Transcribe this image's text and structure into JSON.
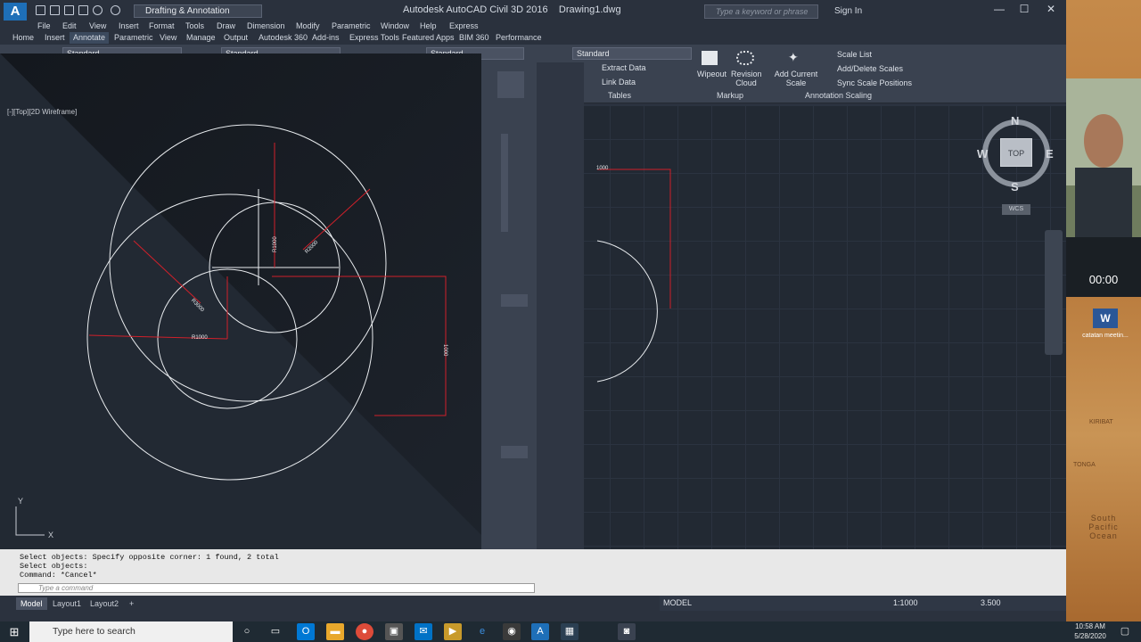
{
  "title_bar": {
    "app_title": "Autodesk AutoCAD Civil 3D 2016",
    "file_name": "Drawing1.dwg",
    "workspace": "Drafting & Annotation",
    "search_placeholder": "Type a keyword or phrase",
    "sign_in": "Sign In"
  },
  "menu": [
    "File",
    "Edit",
    "View",
    "Insert",
    "Format",
    "Tools",
    "Draw",
    "Dimension",
    "Modify",
    "Parametric",
    "Window",
    "Help",
    "Express"
  ],
  "ribbon_tabs": [
    "Home",
    "Insert",
    "Annotate",
    "Parametric",
    "View",
    "Manage",
    "Output",
    "Autodesk 360",
    "Add-ins",
    "Express Tools",
    "Featured Apps",
    "BIM 360",
    "Performance"
  ],
  "active_tab": "Annotate",
  "ribbon": {
    "text_style": "Standard",
    "dim_style": "Standard",
    "mleader_style": "Standard",
    "table_style": "Standard",
    "extract_data": "Extract Data",
    "link_data": "Link Data",
    "tables_panel": "Tables",
    "wipeout": "Wipeout",
    "revision_cloud": "Revision Cloud",
    "markup_panel": "Markup",
    "add_current_scale": "Add Current Scale",
    "scale_list": "Scale List",
    "add_delete_scales": "Add/Delete Scales",
    "sync_scale_positions": "Sync Scale Positions",
    "annotation_scaling_panel": "Annotation Scaling"
  },
  "viewport_label": "[-][Top][2D Wireframe]",
  "viewcube": {
    "top": "TOP",
    "north": "N",
    "south": "S",
    "east": "E",
    "west": "W",
    "wcs": "WCS"
  },
  "drawing_labels": {
    "r1000_a": "R1000",
    "r1000_b": "R1000",
    "r2000": "R2000",
    "d3000": "R3000",
    "dim_1000_top": "1000",
    "dim_1000_side": "1000"
  },
  "command": {
    "history": [
      "Select objects: Specify opposite corner: 1 found, 2 total",
      "Select objects:",
      "Command: *Cancel*"
    ],
    "placeholder": "Type a command"
  },
  "layout_tabs": [
    "Model",
    "Layout1",
    "Layout2"
  ],
  "status": {
    "model": "MODEL",
    "scale": "1:1000",
    "annotation_value": "3.500"
  },
  "webcam": {
    "timer": "00:00"
  },
  "desktop": {
    "word_label": "catatan meetin..."
  },
  "map_labels": {
    "kiribati": "KIRIBAT",
    "tonga": "TONGA",
    "ocean": "South Pacific Ocean"
  },
  "taskbar": {
    "search_placeholder": "Type here to search",
    "time": "10:58 AM",
    "date": "5/28/2020"
  },
  "colors": {
    "accent": "#1e6fb8",
    "canvas": "#222933",
    "dimension": "#d0202a"
  }
}
